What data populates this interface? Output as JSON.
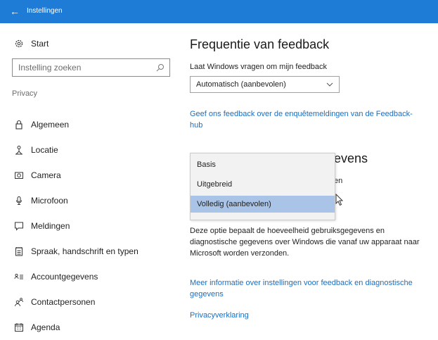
{
  "titlebar": {
    "title": "Instellingen",
    "back_icon": "back-arrow-icon",
    "color": "#1e7bd6"
  },
  "sidebar": {
    "start_label": "Start",
    "search_placeholder": "Instelling zoeken",
    "section_label": "Privacy",
    "items": [
      {
        "label": "Algemeen",
        "icon": "lock-icon"
      },
      {
        "label": "Locatie",
        "icon": "location-person-icon"
      },
      {
        "label": "Camera",
        "icon": "camera-icon"
      },
      {
        "label": "Microfoon",
        "icon": "microphone-icon"
      },
      {
        "label": "Meldingen",
        "icon": "message-icon"
      },
      {
        "label": "Spraak, handschrift en typen",
        "icon": "notepad-icon"
      },
      {
        "label": "Accountgegevens",
        "icon": "account-info-icon"
      },
      {
        "label": "Contactpersonen",
        "icon": "contacts-icon"
      },
      {
        "label": "Agenda",
        "icon": "calendar-icon"
      }
    ]
  },
  "main": {
    "heading": "Frequentie van feedback",
    "frequency_label": "Laat Windows vragen om mijn feedback",
    "frequency_value": "Automatisch (aanbevolen)",
    "feedback_link": [
      "Geef ons feedback over de enquêtemeldingen van de Feedback-",
      "hub"
    ],
    "heading2_visible": "evens",
    "label2_visible": "en",
    "options": [
      "Basis",
      "Uitgebreid",
      "Volledig (aanbevolen)"
    ],
    "selected_option": "Volledig (aanbevolen)",
    "description": [
      "Deze optie bepaalt de hoeveelheid gebruiksgegevens en",
      "diagnostische gegevens over Windows die vanaf uw apparaat naar",
      "Microsoft worden verzonden."
    ],
    "more_info_link": [
      "Meer informatie over instellingen voor feedback en diagnostische",
      "gegevens"
    ],
    "privacy_link": "Privacyverklaring",
    "link_color": "#1b6ec2",
    "selection_color": "#a9c4e6"
  }
}
